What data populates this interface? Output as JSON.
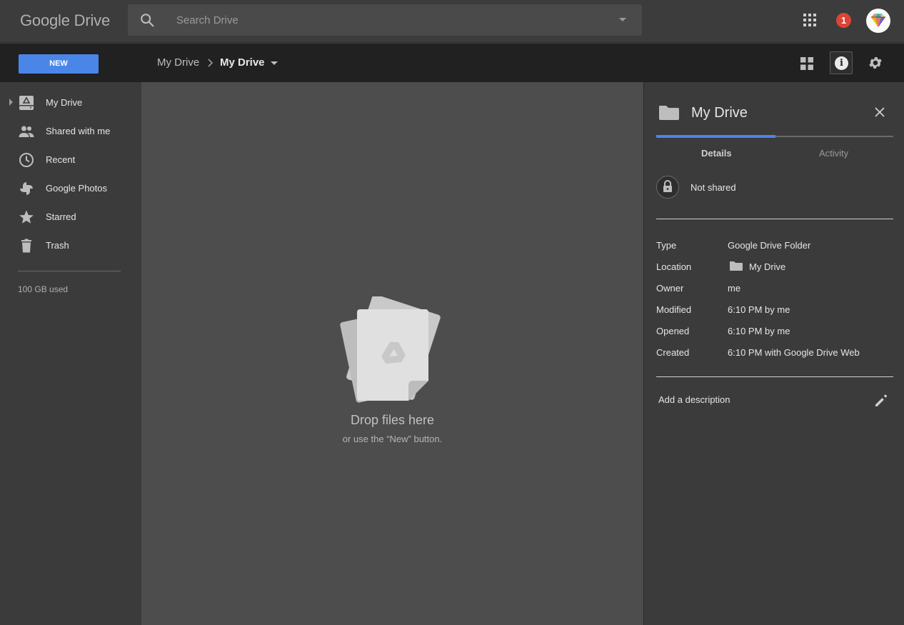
{
  "header": {
    "logo": "Google Drive",
    "search_placeholder": "Search Drive",
    "notification_count": "1"
  },
  "toolbar": {
    "new_label": "NEW",
    "breadcrumb_root": "My Drive",
    "breadcrumb_current": "My Drive"
  },
  "sidebar": {
    "items": [
      {
        "label": "My Drive",
        "icon": "drive-icon"
      },
      {
        "label": "Shared with me",
        "icon": "people-icon"
      },
      {
        "label": "Recent",
        "icon": "clock-icon"
      },
      {
        "label": "Google Photos",
        "icon": "pinwheel-icon"
      },
      {
        "label": "Starred",
        "icon": "star-icon"
      },
      {
        "label": "Trash",
        "icon": "trash-icon"
      }
    ],
    "storage": "100 GB used"
  },
  "main": {
    "drop_title": "Drop files here",
    "drop_subtitle": "or use the “New” button."
  },
  "details_panel": {
    "title": "My Drive",
    "tabs": [
      "Details",
      "Activity"
    ],
    "active_tab": "Details",
    "sharing": "Not shared",
    "rows": {
      "type": {
        "key": "Type",
        "value": "Google Drive Folder"
      },
      "location": {
        "key": "Location",
        "value": "My Drive"
      },
      "owner": {
        "key": "Owner",
        "value": "me"
      },
      "modified": {
        "key": "Modified",
        "value": "6:10 PM by me"
      },
      "opened": {
        "key": "Opened",
        "value": "6:10 PM by me"
      },
      "created": {
        "key": "Created",
        "value": "6:10 PM with Google Drive Web"
      }
    },
    "description_prompt": "Add a description"
  },
  "colors": {
    "accent": "#4a86e8",
    "notification": "#db4437",
    "topbar": "#3c3c3c",
    "subbar": "#212121",
    "main": "#4d4d4d"
  }
}
